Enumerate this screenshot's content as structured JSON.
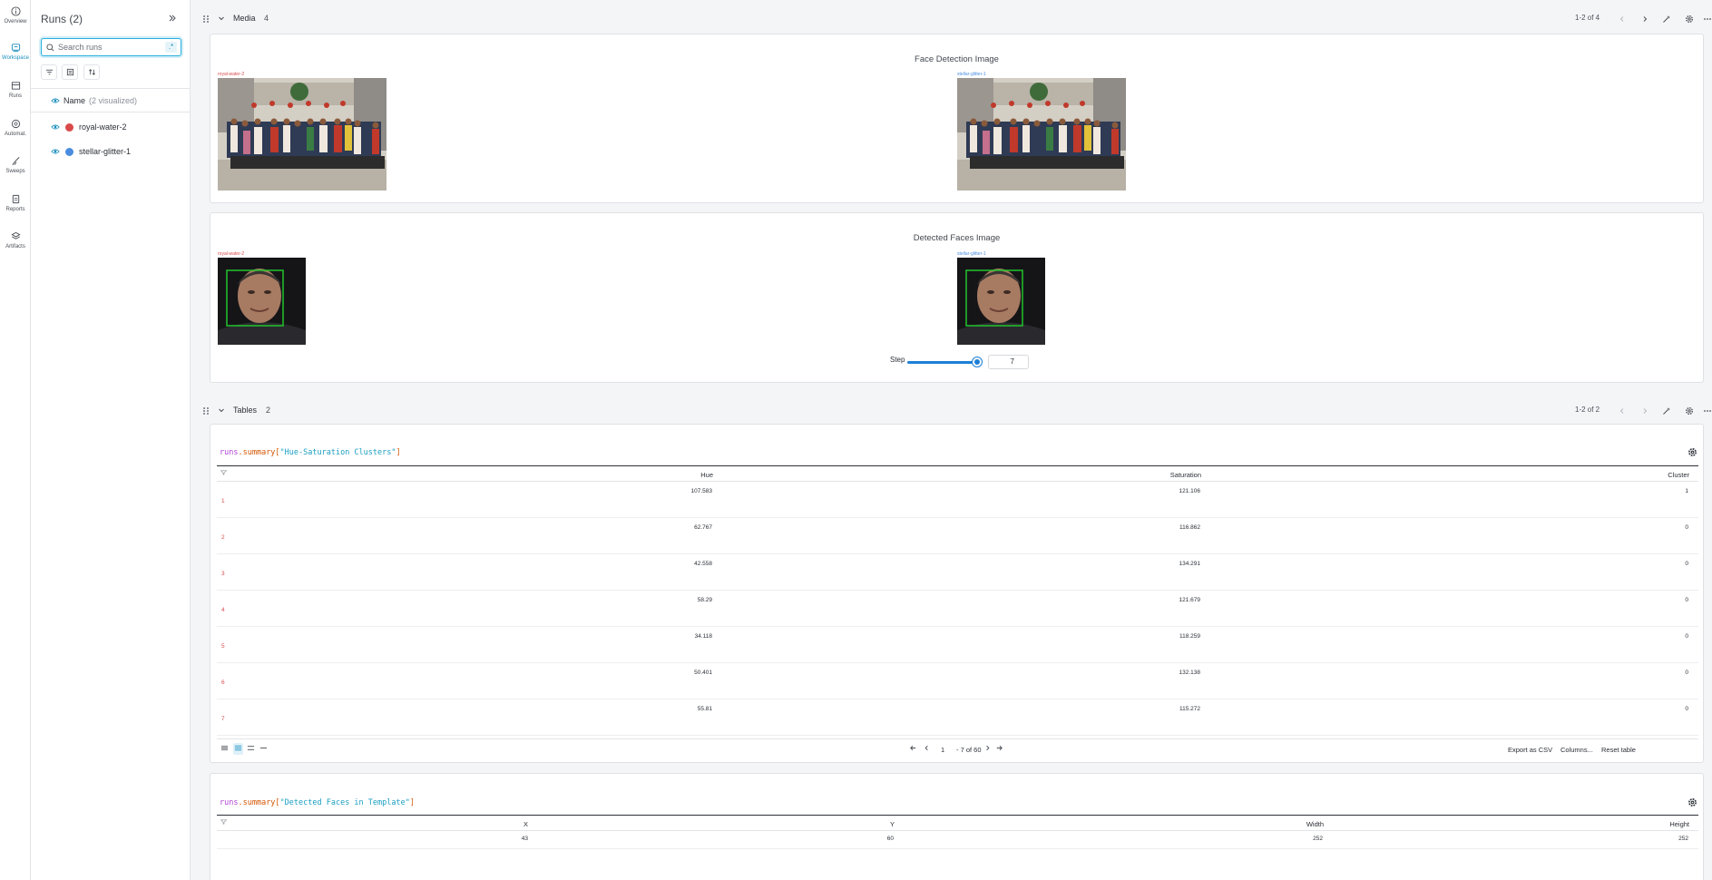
{
  "nav": [
    {
      "label": "Overview",
      "icon": "info-icon"
    },
    {
      "label": "Workspace",
      "icon": "workspace-icon",
      "active": true
    },
    {
      "label": "Runs",
      "icon": "table-icon"
    },
    {
      "label": "Automat.",
      "icon": "automation-icon"
    },
    {
      "label": "Sweeps",
      "icon": "broom-icon"
    },
    {
      "label": "Reports",
      "icon": "report-icon"
    },
    {
      "label": "Artifacts",
      "icon": "layers-icon"
    }
  ],
  "runs_panel": {
    "title": "Runs (2)",
    "search_placeholder": "Search runs",
    "regex": ".*",
    "header_name": "Name",
    "header_count": "(2 visualized)",
    "runs": [
      {
        "name": "royal-water-2",
        "color": "#d94a4a"
      },
      {
        "name": "stellar-glitter-1",
        "color": "#4a8de0"
      }
    ]
  },
  "media_section": {
    "name": "Media",
    "count": "4",
    "pager": "1-2 of 4",
    "panel1": {
      "title": "Face Detection Image",
      "label_left": "royal-water-2",
      "label_right": "stellar-glitter-1"
    },
    "panel2": {
      "title": "Detected Faces Image",
      "label_left": "royal-water-2",
      "label_right": "stellar-glitter-1",
      "step_label": "Step",
      "step_value": "7"
    }
  },
  "tables_section": {
    "name": "Tables",
    "count": "2",
    "pager": "1-2 of 2",
    "table1": {
      "query_prefix": "runs",
      "query_mid": ".summary[",
      "query_key": "\"Hue-Saturation Clusters\"",
      "query_end": "]",
      "columns": [
        "Hue",
        "Saturation",
        "Cluster"
      ],
      "rows": [
        {
          "idx": "1",
          "hue": "107.583",
          "sat": "121.106",
          "cluster": "1"
        },
        {
          "idx": "2",
          "hue": "62.767",
          "sat": "116.862",
          "cluster": "0"
        },
        {
          "idx": "3",
          "hue": "42.558",
          "sat": "134.291",
          "cluster": "0"
        },
        {
          "idx": "4",
          "hue": "58.29",
          "sat": "121.679",
          "cluster": "0"
        },
        {
          "idx": "5",
          "hue": "34.118",
          "sat": "118.259",
          "cluster": "0"
        },
        {
          "idx": "6",
          "hue": "50.401",
          "sat": "132.138",
          "cluster": "0"
        },
        {
          "idx": "7",
          "hue": "55.81",
          "sat": "115.272",
          "cluster": "0"
        }
      ],
      "pagination": {
        "page": "1",
        "range": "- 7 of 60"
      },
      "footer": {
        "export": "Export as CSV",
        "columns": "Columns...",
        "reset": "Reset table"
      }
    },
    "table2": {
      "query_prefix": "runs",
      "query_mid": ".summary[",
      "query_key": "\"Detected Faces in Template\"",
      "query_end": "]",
      "columns": [
        "X",
        "Y",
        "Width",
        "Height"
      ],
      "row": {
        "x": "43",
        "y": "60",
        "width": "252",
        "height": "252"
      }
    }
  }
}
